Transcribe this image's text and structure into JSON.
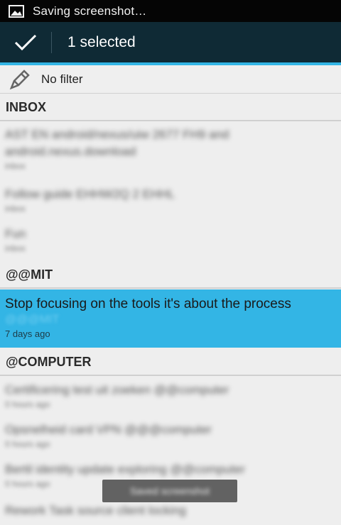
{
  "status_bar": {
    "text": "Saving screenshot…",
    "icon": "image-icon"
  },
  "action_bar": {
    "title": "1 selected",
    "confirm_icon": "check-icon"
  },
  "filter": {
    "label": "No filter",
    "icon": "pencil-tag-icon"
  },
  "sections": {
    "inbox": {
      "header": "INBOX",
      "items": [
        {
          "line1": "AST EN android/nexus/uiw 2677 FH9 and",
          "line2": "android.nexus.download",
          "meta": "inbox"
        },
        {
          "line1": "Follow guide EHHW2Q 2 EHHL",
          "meta": "inbox"
        },
        {
          "line1": "Fun",
          "meta": "inbox"
        }
      ]
    },
    "mit": {
      "header": "@@MIT",
      "selected_item": {
        "title": "Stop focusing on the tools it's about the process",
        "context": "@@@MIT",
        "age": "7 days ago"
      }
    },
    "computer": {
      "header": "@COMPUTER",
      "items": [
        {
          "line1": "Certificering test uit zoeken @@computer",
          "meta": "0 hours ago"
        },
        {
          "line1": "Opsnelheid card VPN @@@computer",
          "meta": "0 hours ago"
        },
        {
          "line1": "Bertil identity update exploring @@computer",
          "meta": "0 hours ago"
        },
        {
          "line1": "Rework Task source client locking",
          "meta": ""
        }
      ]
    }
  },
  "toast": {
    "text": "Saved screenshot"
  },
  "colors": {
    "accent": "#33b5e5",
    "action_bar": "#0f2a35",
    "status_bar": "#050505"
  }
}
